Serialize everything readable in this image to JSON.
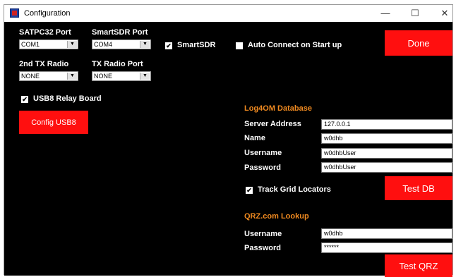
{
  "window": {
    "title": "Configuration",
    "controls": {
      "minimize": "—",
      "maximize": "☐",
      "close": "✕"
    }
  },
  "ports": {
    "satpc32_label": "SATPC32 Port",
    "satpc32_value": "COM1",
    "smartsdr_label": "SmartSDR Port",
    "smartsdr_value": "COM4",
    "tx2_label": "2nd TX Radio",
    "tx2_value": "NONE",
    "txport_label": "TX Radio Port",
    "txport_value": "NONE"
  },
  "options": {
    "smartsdr_label": "SmartSDR",
    "smartsdr_checked": true,
    "autoconnect_label": "Auto Connect on Start up",
    "autoconnect_checked": false,
    "usb8_label": "USB8 Relay Board",
    "usb8_checked": true,
    "trackgrid_label": "Track Grid Locators",
    "trackgrid_checked": true
  },
  "buttons": {
    "done": "Done",
    "config_usb8": "Config USB8",
    "test_db": "Test DB",
    "test_qrz": "Test QRZ"
  },
  "log4om": {
    "heading": "Log4OM Database",
    "server_label": "Server Address",
    "server_value": "127.0.0.1",
    "name_label": "Name",
    "name_value": "w0dhb",
    "username_label": "Username",
    "username_value": "w0dhbUser",
    "password_label": "Password",
    "password_value": "w0dhbUser"
  },
  "qrz": {
    "heading": "QRZ.com Lookup",
    "username_label": "Username",
    "username_value": "w0dhb",
    "password_label": "Password",
    "password_value": "******"
  },
  "colors": {
    "background": "#000000",
    "button": "#ff0f0f",
    "section_heading": "#f08a20"
  }
}
